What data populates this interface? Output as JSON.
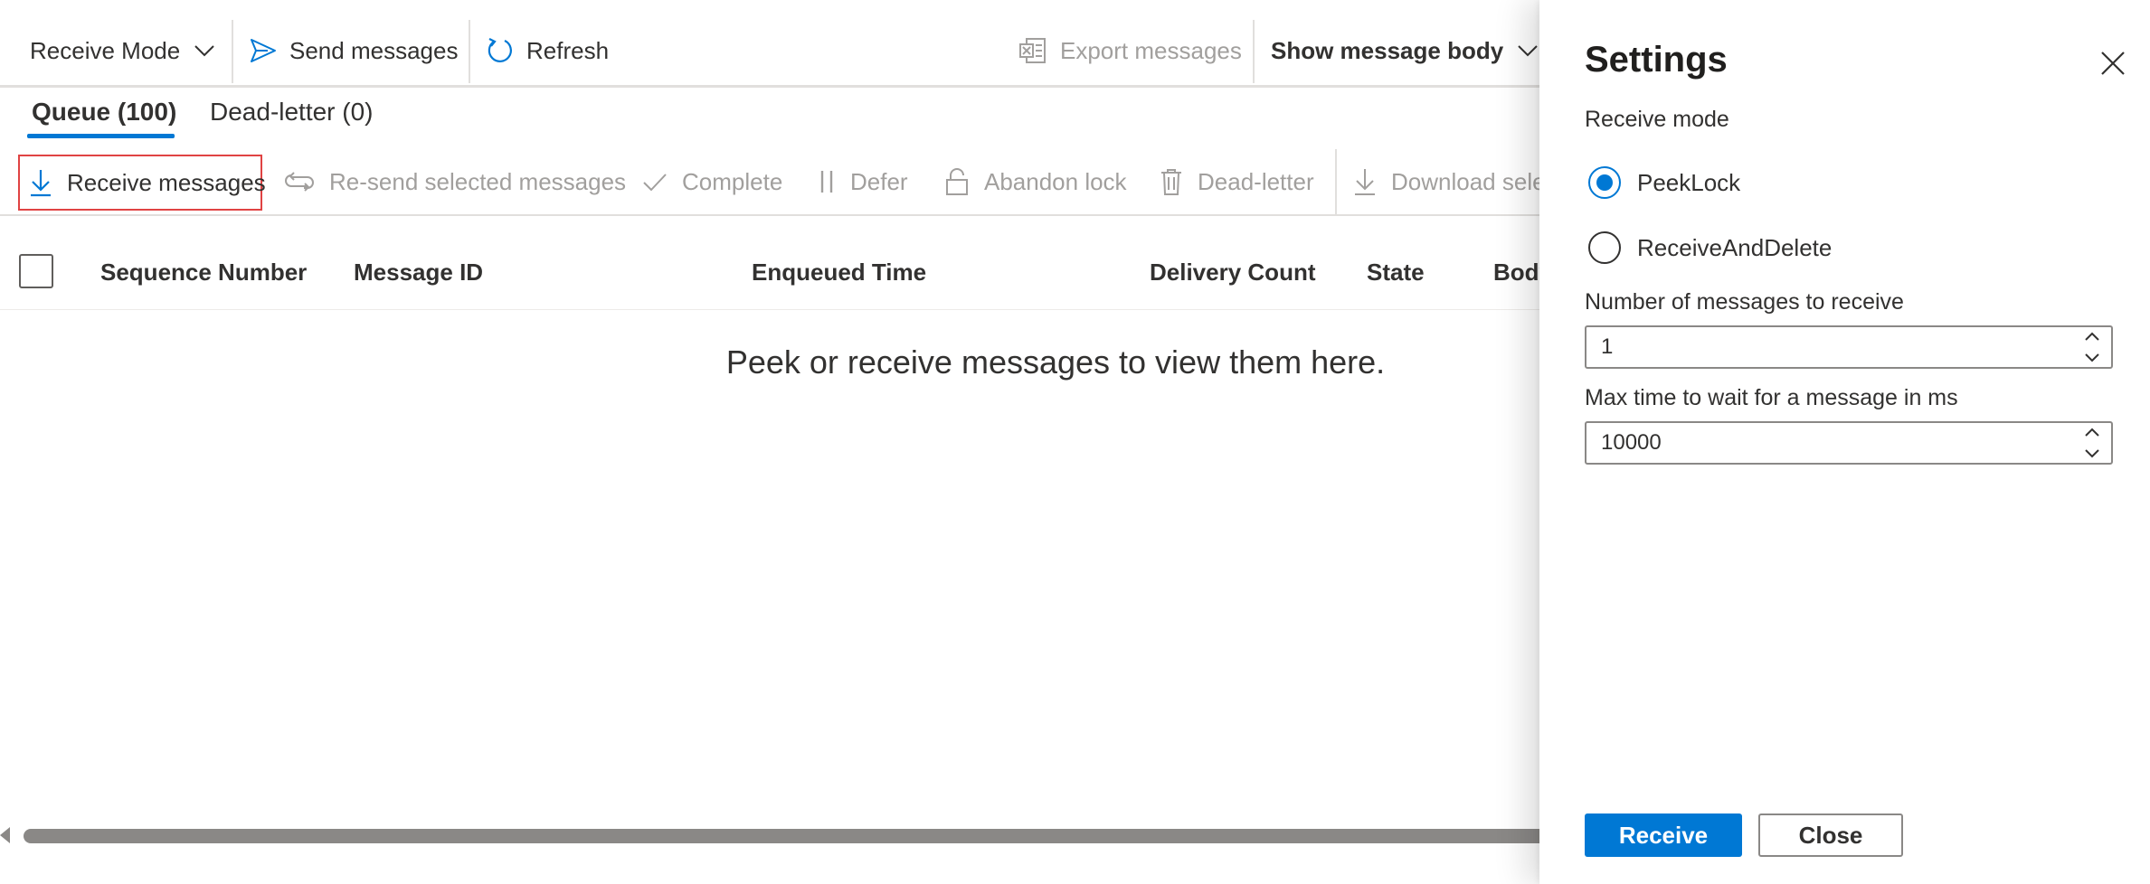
{
  "colors": {
    "accent": "#0078d4",
    "text": "#323130",
    "disabled": "#a19f9d",
    "highlight_border": "#e04343"
  },
  "toolbar": {
    "receive_mode": "Receive Mode",
    "send": "Send messages",
    "refresh": "Refresh",
    "export": "Export messages",
    "show_body": "Show message body"
  },
  "tabs": {
    "queue": "Queue (100)",
    "deadletter": "Dead-letter (0)"
  },
  "commands": {
    "receive": "Receive messages",
    "resend": "Re-send selected messages",
    "complete": "Complete",
    "defer": "Defer",
    "abandon": "Abandon lock",
    "deadletter": "Dead-letter",
    "download": "Download sele"
  },
  "grid": {
    "columns": [
      "Sequence Number",
      "Message ID",
      "Enqueued Time",
      "Delivery Count",
      "State",
      "Body"
    ],
    "empty_message": "Peek or receive messages to view them here."
  },
  "settings": {
    "title": "Settings",
    "receive_mode_label": "Receive mode",
    "options": [
      "PeekLock",
      "ReceiveAndDelete"
    ],
    "selected_option": "PeekLock",
    "num_messages_label": "Number of messages to receive",
    "num_messages_value": "1",
    "max_wait_label": "Max time to wait for a message in ms",
    "max_wait_value": "10000",
    "receive_button": "Receive",
    "close_button": "Close"
  },
  "icons": [
    "chevron-down-icon",
    "send-icon",
    "refresh-icon",
    "excel-icon",
    "download-icon",
    "resend-icon",
    "check-icon",
    "pause-icon",
    "lock-icon",
    "trash-icon",
    "close-icon"
  ]
}
